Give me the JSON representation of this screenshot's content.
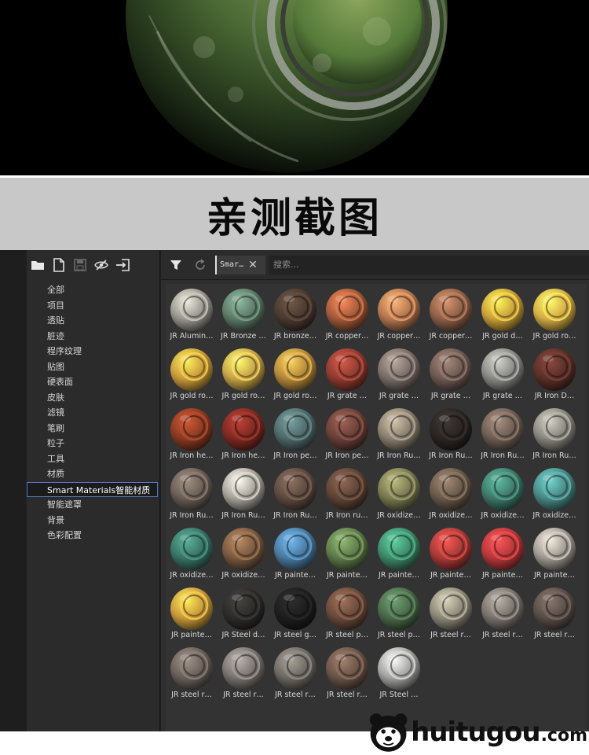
{
  "banner": {
    "title": "亲测截图"
  },
  "toolbar": {
    "filter_chip": "Smar…",
    "search_placeholder": "搜索..."
  },
  "sidebar": {
    "categories": [
      {
        "label": "全部"
      },
      {
        "label": "项目"
      },
      {
        "label": "透贴"
      },
      {
        "label": "脏迹"
      },
      {
        "label": "程序纹理"
      },
      {
        "label": "贴图"
      },
      {
        "label": "硬表面"
      },
      {
        "label": "皮肤"
      },
      {
        "label": "滤镜"
      },
      {
        "label": "笔刷"
      },
      {
        "label": "粒子"
      },
      {
        "label": "工具"
      },
      {
        "label": "材质"
      },
      {
        "label": "Smart Materials智能材质",
        "selected": true
      },
      {
        "label": "智能遮罩"
      },
      {
        "label": "背景"
      },
      {
        "label": "色彩配置"
      }
    ]
  },
  "materials": [
    {
      "label": "JR Alumin…",
      "color": "#9a9890"
    },
    {
      "label": "JR Bronze …",
      "color": "#5d7a68"
    },
    {
      "label": "JR bronze…",
      "color": "#4a3a30"
    },
    {
      "label": "JR copper…",
      "color": "#a35a3a"
    },
    {
      "label": "JR copper…",
      "color": "#b4774f"
    },
    {
      "label": "JR copper…",
      "color": "#8e6148"
    },
    {
      "label": "JR gold d…",
      "color": "#c9a13a"
    },
    {
      "label": "JR gold ro…",
      "color": "#d4ad45"
    },
    {
      "label": "JR gold ro…",
      "color": "#c99c3c"
    },
    {
      "label": "JR gold ro…",
      "color": "#c7a448"
    },
    {
      "label": "JR gold ro…",
      "color": "#b48a3c"
    },
    {
      "label": "JR grate …",
      "color": "#8e3b30"
    },
    {
      "label": "JR grate …",
      "color": "#7a6e68"
    },
    {
      "label": "JR grate …",
      "color": "#6e5a52"
    },
    {
      "label": "JR grate …",
      "color": "#8a8a86"
    },
    {
      "label": "JR Iron D…",
      "color": "#5a3028"
    },
    {
      "label": "JR Iron he…",
      "color": "#8a3a22"
    },
    {
      "label": "JR Iron he…",
      "color": "#7e2a22"
    },
    {
      "label": "JR Iron pe…",
      "color": "#4f6a6a"
    },
    {
      "label": "JR Iron pe…",
      "color": "#6a4038"
    },
    {
      "label": "JR Iron Ru…",
      "color": "#8a8070"
    },
    {
      "label": "JR Iron Ru…",
      "color": "#2a2522"
    },
    {
      "label": "JR Iron Ru…",
      "color": "#6e5e54"
    },
    {
      "label": "JR Iron Ru…",
      "color": "#8a8880"
    },
    {
      "label": "JR Iron Ru…",
      "color": "#6a5e56"
    },
    {
      "label": "JR Iron Ru…",
      "color": "#a8a49c"
    },
    {
      "label": "JR Iron Ru…",
      "color": "#5e4a40"
    },
    {
      "label": "JR Iron ru…",
      "color": "#5e4436"
    },
    {
      "label": "JR oxidize…",
      "color": "#7a7a52"
    },
    {
      "label": "JR oxidize…",
      "color": "#6a5a4a"
    },
    {
      "label": "JR oxidize…",
      "color": "#3e7a6a"
    },
    {
      "label": "JR oxidize…",
      "color": "#4a8a86"
    },
    {
      "label": "JR oxidize…",
      "color": "#3a7466"
    },
    {
      "label": "JR oxidize…",
      "color": "#7a5a40"
    },
    {
      "label": "JR painte…",
      "color": "#4a7aa0"
    },
    {
      "label": "JR painte…",
      "color": "#5e7a4a"
    },
    {
      "label": "JR painte…",
      "color": "#3e8a6a"
    },
    {
      "label": "JR painte…",
      "color": "#a83a36"
    },
    {
      "label": "JR painte…",
      "color": "#b8383a"
    },
    {
      "label": "JR painte…",
      "color": "#a09a92"
    },
    {
      "label": "JR painte…",
      "color": "#c99a3a"
    },
    {
      "label": "JR Steel d…",
      "color": "#2e2c2a"
    },
    {
      "label": "JR steel g…",
      "color": "#1e1e1e"
    },
    {
      "label": "JR steel p…",
      "color": "#6a4a3a"
    },
    {
      "label": "JR steel p…",
      "color": "#4a6a4a"
    },
    {
      "label": "JR steel r…",
      "color": "#8e8a7a"
    },
    {
      "label": "JR steel r…",
      "color": "#7a746e"
    },
    {
      "label": "JR steel r…",
      "color": "#5a4e48"
    },
    {
      "label": "JR steel r…",
      "color": "#6a605a"
    },
    {
      "label": "JR steel r…",
      "color": "#7a7470"
    },
    {
      "label": "JR steel r…",
      "color": "#6e6a64"
    },
    {
      "label": "JR steel r…",
      "color": "#6a5448"
    },
    {
      "label": "JR Steel …",
      "color": "#a4a4a2"
    }
  ],
  "watermark": {
    "name": "huitugou",
    "tld": ".com"
  }
}
